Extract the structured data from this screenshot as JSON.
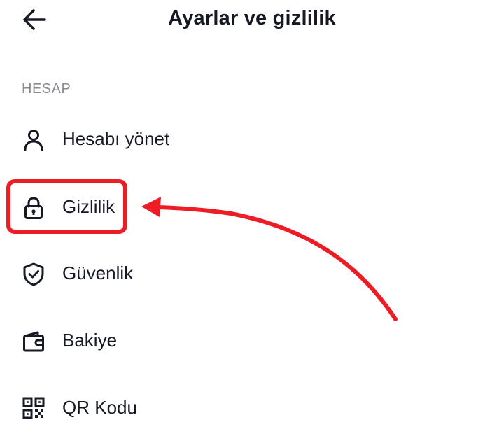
{
  "header": {
    "title": "Ayarlar ve gizlilik",
    "back_icon": "arrow-left-icon"
  },
  "section": {
    "header": "HESAP"
  },
  "items": [
    {
      "label": "Hesabı yönet",
      "icon": "person-icon"
    },
    {
      "label": "Gizlilik",
      "icon": "lock-icon"
    },
    {
      "label": "Güvenlik",
      "icon": "shield-check-icon"
    },
    {
      "label": "Bakiye",
      "icon": "wallet-icon"
    },
    {
      "label": "QR Kodu",
      "icon": "qr-code-icon"
    }
  ],
  "annotation": {
    "color": "#ee1d25",
    "highlighted_item": "Gizlilik"
  }
}
